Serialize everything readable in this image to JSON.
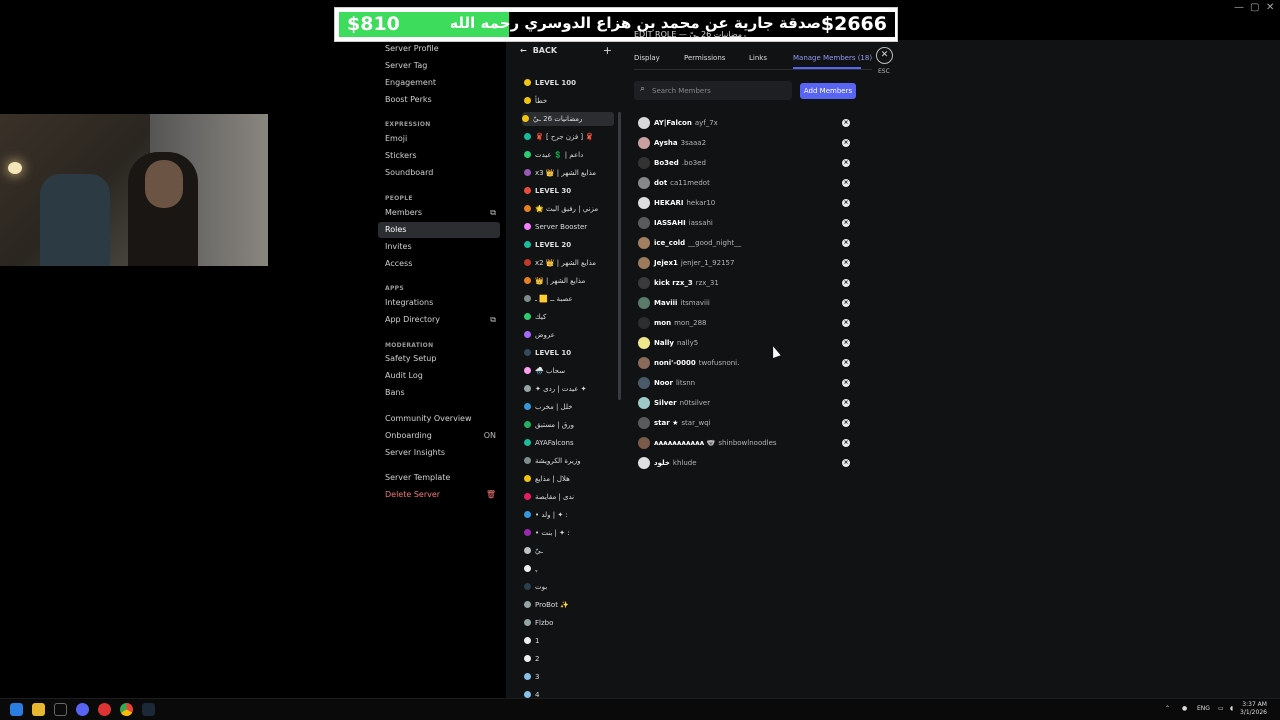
{
  "banner": {
    "amount_left": "$810",
    "amount_right": "$2666",
    "text": "صدقة جارية عن محمد بن هزاع الدوسري رحمه الله",
    "subtitle": "EDIT ROLE — رمضانيات 26 ـيّ"
  },
  "sidebar": {
    "top_items": [
      "Server Profile",
      "Server Tag",
      "Engagement",
      "Boost Perks"
    ],
    "expression_header": "EXPRESSION",
    "expression_items": [
      "Emoji",
      "Stickers",
      "Soundboard"
    ],
    "people_header": "PEOPLE",
    "people_items": [
      "Members",
      "Roles",
      "Invites",
      "Access"
    ],
    "apps_header": "APPS",
    "apps_items": [
      "Integrations",
      "App Directory"
    ],
    "moderation_header": "MODERATION",
    "moderation_items": [
      "Safety Setup",
      "Audit Log",
      "Bans"
    ],
    "community_items": [
      "Community Overview",
      "Onboarding",
      "Server Insights"
    ],
    "onboarding_status": "ON",
    "server_template": "Server Template",
    "delete_server": "Delete Server"
  },
  "roles_panel": {
    "back_label": "BACK",
    "plus": "+",
    "roles": [
      {
        "name": "LEVEL 100",
        "color": "#f1c40f",
        "bold": true
      },
      {
        "name": "خطأ",
        "color": "#f1c40f"
      },
      {
        "name": "رمضانيات 26 ـيّ",
        "color": "#f1c40f"
      },
      {
        "name": "🧣 [ فزن جرح ] 🧣",
        "color": "#1abc9c"
      },
      {
        "name": "داعم | 💲 عيدت",
        "color": "#2ecc71"
      },
      {
        "name": "x3 👑 | مذايع الشهر",
        "color": "#9b59b6"
      },
      {
        "name": "LEVEL 30",
        "color": "#e74c3c",
        "bold": true
      },
      {
        "name": "🌟 مزني | رفيق البث",
        "color": "#e67e22"
      },
      {
        "name": "Server Booster",
        "color": "#f47fff"
      },
      {
        "name": "LEVEL 20",
        "color": "#1abc9c",
        "bold": true
      },
      {
        "name": "x2 👑 | مذايع الشهر",
        "color": "#c0392b"
      },
      {
        "name": "👑 | مذايع الشهر",
        "color": "#e67e22"
      },
      {
        "name": "عصبة ــ 🟨 ـ",
        "color": "#7f8c8d"
      },
      {
        "name": "كيك",
        "color": "#2ecc71"
      },
      {
        "name": "عروض",
        "color": "#a569ff"
      },
      {
        "name": "LEVEL 10",
        "color": "#34495e",
        "bold": true
      },
      {
        "name": "🌧️ سحاب",
        "color": "#ff9ff3"
      },
      {
        "name": "✦ عيدت | ردى ✦",
        "color": "#95a5a6"
      },
      {
        "name": "خلل | مخرب",
        "color": "#3498db"
      },
      {
        "name": "ورق | مستبق",
        "color": "#27ae60"
      },
      {
        "name": "AYAFalcons",
        "color": "#1abc9c"
      },
      {
        "name": "وزيرة الكرويشة",
        "color": "#7f8c8d"
      },
      {
        "name": "هلال | مذايع",
        "color": "#f1c40f"
      },
      {
        "name": "ندى | مقايصة",
        "color": "#e91e63"
      },
      {
        "name": "• ولد | ✦ :",
        "color": "#3498db"
      },
      {
        "name": "• بنت | ✦ :",
        "color": "#9c27b0"
      },
      {
        "name": "ـيّ",
        "color": "#bdc3c7"
      },
      {
        "name": "ﮩ",
        "color": "#ecf0f1"
      },
      {
        "name": "بوت",
        "color": "#2c3e50"
      },
      {
        "name": "ProBot ✨",
        "color": "#95a5a6"
      },
      {
        "name": "Flzbo",
        "color": "#95a5a6"
      },
      {
        "name": "1",
        "color": "#ecf0f1"
      },
      {
        "name": "2",
        "color": "#ecf0f1"
      },
      {
        "name": "3",
        "color": "#85c1e9"
      },
      {
        "name": "4",
        "color": "#85c1e9"
      }
    ]
  },
  "main": {
    "tabs": [
      "Display",
      "Permissions",
      "Links",
      "Manage Members (18)"
    ],
    "esc_label": "ESC",
    "search_placeholder": "Search Members",
    "add_members": "Add Members",
    "members": [
      {
        "name": "AY|Falcon",
        "username": "ayf_7x",
        "color": "#d9d9d9"
      },
      {
        "name": "Aysha",
        "username": "3saaa2",
        "color": "#c9a0a0"
      },
      {
        "name": "Bo3ed",
        "username": ".bo3ed",
        "color": "#333333"
      },
      {
        "name": "dot",
        "username": "ca11medot",
        "color": "#888888"
      },
      {
        "name": "HEKARI",
        "username": "hekar10",
        "color": "#dddddd"
      },
      {
        "name": "IASSAHI",
        "username": "iassahi",
        "color": "#5b5b5b"
      },
      {
        "name": "ice_cold",
        "username": "__good_night__",
        "color": "#a08060"
      },
      {
        "name": "Jejex1",
        "username": "jenjer_1_92157",
        "color": "#9b7b5b"
      },
      {
        "name": "kick rzx_3",
        "username": "rzx_31",
        "color": "#3a3a3a"
      },
      {
        "name": "Maviii",
        "username": "itsmaviii",
        "color": "#5a7a6a"
      },
      {
        "name": "mon",
        "username": "mon_288",
        "color": "#2e2e2e"
      },
      {
        "name": "Nally",
        "username": "nally5",
        "color": "#f0e68c"
      },
      {
        "name": "noni'-0000",
        "username": "twofusnoni.",
        "color": "#8a6a5a"
      },
      {
        "name": "Noor",
        "username": "litsnn",
        "color": "#4a5a6a"
      },
      {
        "name": "Silver",
        "username": "n0tsilver",
        "color": "#9ec9c9"
      },
      {
        "name": "star ★",
        "username": "star_wqi",
        "color": "#5a5a5a"
      },
      {
        "name": "ᴀᴀᴀᴀᴀᴀᴀᴀᴀᴀᴀ 🐨",
        "username": "shinbowlnoodles",
        "color": "#7a5a4a"
      },
      {
        "name": "خلود",
        "username": "khlude",
        "color": "#e0e0e0"
      }
    ]
  },
  "taskbar": {
    "lang": "ENG",
    "time": "3:37 AM",
    "date": "3/1/2026"
  }
}
